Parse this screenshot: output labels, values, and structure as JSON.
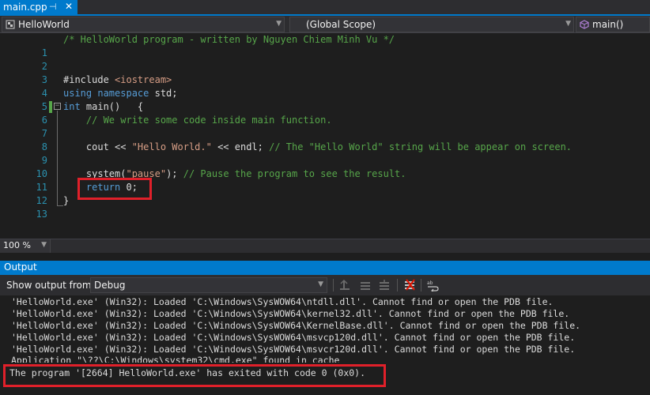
{
  "tab": {
    "title": "main.cpp",
    "pin_glyph": "⊣",
    "close_glyph": "✕"
  },
  "navbar": {
    "project": "HelloWorld",
    "scope": "(Global Scope)",
    "member": "main()",
    "project_icon": "cpp-project-icon",
    "member_icon": "method-cube-icon"
  },
  "editor": {
    "line_numbers": [
      "1",
      "2",
      "3",
      "4",
      "5",
      "6",
      "7",
      "8",
      "9",
      "10",
      "11",
      "12",
      "13"
    ],
    "header_comment": "/* HelloWorld program - written by Nguyen Chiem Minh Vu */",
    "lines": {
      "l3_pre": "#include ",
      "l3_str": "<iostream>",
      "l4_kw": "using namespace",
      "l4_rest": " std;",
      "l6_kw": "int",
      "l6_rest": " main()   {",
      "l7": "    // We write some code inside main function.",
      "l9_pre": "    cout << ",
      "l9_str": "\"Hello World.\"",
      "l9_mid": " << endl; ",
      "l9_comment": "// The \"Hello World\" string will be appear on screen.",
      "l11_pre": "    system(",
      "l11_str": "\"pause\"",
      "l11_mid": "); ",
      "l11_comment": "// Pause the program to see the result.",
      "l12_kw": "    return",
      "l12_rest": " 0;",
      "l13": "}"
    }
  },
  "zoom": {
    "value": "100 %"
  },
  "output": {
    "title": "Output",
    "show_from_label": "Show output from:",
    "source": "Debug",
    "toolbar_icons": [
      "goto-prev-message-icon",
      "goto-next-message-icon",
      "clear-all-icon",
      "toggle-word-wrap-icon"
    ],
    "lines": [
      "'HelloWorld.exe' (Win32): Loaded 'C:\\Windows\\SysWOW64\\ntdll.dll'. Cannot find or open the PDB file.",
      "'HelloWorld.exe' (Win32): Loaded 'C:\\Windows\\SysWOW64\\kernel32.dll'. Cannot find or open the PDB file.",
      "'HelloWorld.exe' (Win32): Loaded 'C:\\Windows\\SysWOW64\\KernelBase.dll'. Cannot find or open the PDB file.",
      "'HelloWorld.exe' (Win32): Loaded 'C:\\Windows\\SysWOW64\\msvcp120d.dll'. Cannot find or open the PDB file.",
      "'HelloWorld.exe' (Win32): Loaded 'C:\\Windows\\SysWOW64\\msvcr120d.dll'. Cannot find or open the PDB file.",
      "Application \"\\??\\C:\\Windows\\system32\\cmd.exe\" found in cache",
      "The program '[2664] HelloWorld.exe' has exited with code 0 (0x0)."
    ]
  },
  "colors": {
    "accent": "#007acc",
    "highlight_box": "#e0202a",
    "comment": "#57a64a",
    "keyword": "#569cd6",
    "string": "#d69d85",
    "line_number": "#2b91af"
  }
}
